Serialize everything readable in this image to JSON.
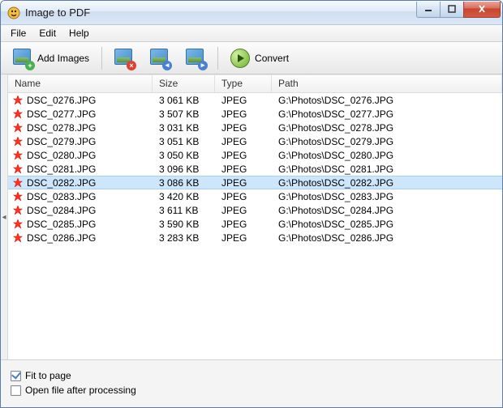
{
  "window": {
    "title": "Image to PDF"
  },
  "menu": {
    "file": "File",
    "edit": "Edit",
    "help": "Help"
  },
  "toolbar": {
    "add_images": "Add Images",
    "convert": "Convert"
  },
  "columns": {
    "name": "Name",
    "size": "Size",
    "type": "Type",
    "path": "Path"
  },
  "rows": [
    {
      "name": "DSC_0276.JPG",
      "size": "3 061 KB",
      "type": "JPEG",
      "path": "G:\\Photos\\DSC_0276.JPG",
      "selected": false
    },
    {
      "name": "DSC_0277.JPG",
      "size": "3 507 KB",
      "type": "JPEG",
      "path": "G:\\Photos\\DSC_0277.JPG",
      "selected": false
    },
    {
      "name": "DSC_0278.JPG",
      "size": "3 031 KB",
      "type": "JPEG",
      "path": "G:\\Photos\\DSC_0278.JPG",
      "selected": false
    },
    {
      "name": "DSC_0279.JPG",
      "size": "3 051 KB",
      "type": "JPEG",
      "path": "G:\\Photos\\DSC_0279.JPG",
      "selected": false
    },
    {
      "name": "DSC_0280.JPG",
      "size": "3 050 KB",
      "type": "JPEG",
      "path": "G:\\Photos\\DSC_0280.JPG",
      "selected": false
    },
    {
      "name": "DSC_0281.JPG",
      "size": "3 096 KB",
      "type": "JPEG",
      "path": "G:\\Photos\\DSC_0281.JPG",
      "selected": false
    },
    {
      "name": "DSC_0282.JPG",
      "size": "3 086 KB",
      "type": "JPEG",
      "path": "G:\\Photos\\DSC_0282.JPG",
      "selected": true
    },
    {
      "name": "DSC_0283.JPG",
      "size": "3 420 KB",
      "type": "JPEG",
      "path": "G:\\Photos\\DSC_0283.JPG",
      "selected": false
    },
    {
      "name": "DSC_0284.JPG",
      "size": "3 611 KB",
      "type": "JPEG",
      "path": "G:\\Photos\\DSC_0284.JPG",
      "selected": false
    },
    {
      "name": "DSC_0285.JPG",
      "size": "3 590 KB",
      "type": "JPEG",
      "path": "G:\\Photos\\DSC_0285.JPG",
      "selected": false
    },
    {
      "name": "DSC_0286.JPG",
      "size": "3 283 KB",
      "type": "JPEG",
      "path": "G:\\Photos\\DSC_0286.JPG",
      "selected": false
    }
  ],
  "options": {
    "fit_to_page": {
      "label": "Fit to page",
      "checked": true
    },
    "open_after": {
      "label": "Open file after processing",
      "checked": false
    }
  }
}
